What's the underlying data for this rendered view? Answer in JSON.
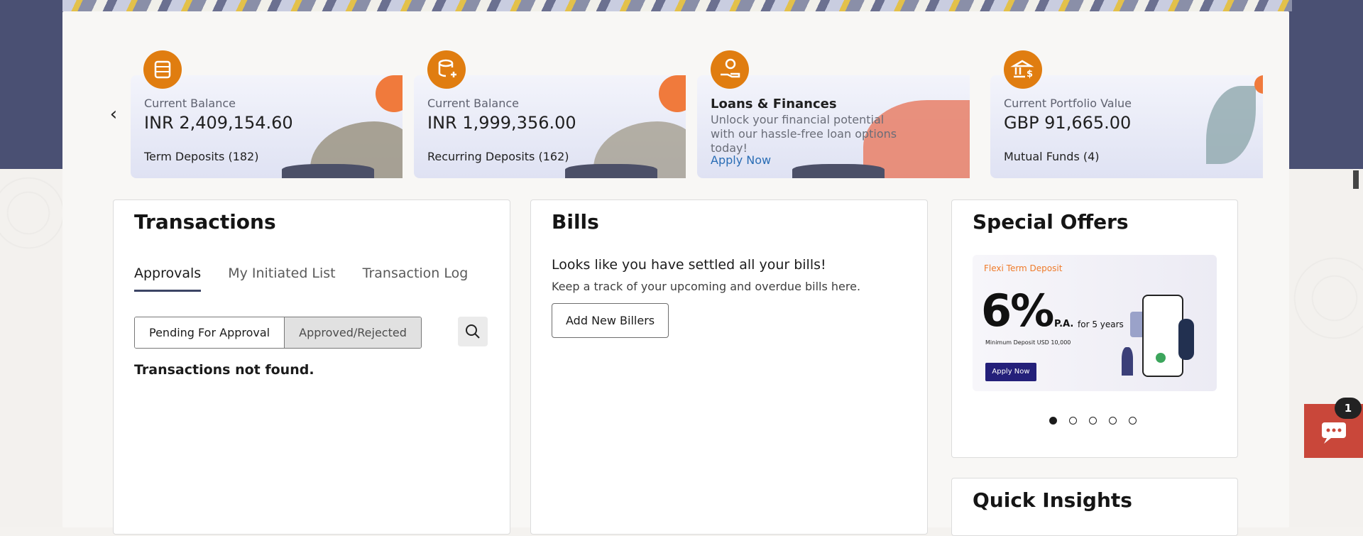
{
  "colors": {
    "hero_band": "#4a5073",
    "accent_orange": "#e07d10",
    "tab_underline": "#3c4565",
    "chat_button": "#c9473a",
    "link": "#2a6db5"
  },
  "carousel": {
    "prev_icon": "chevron-left-icon",
    "cards": [
      {
        "icon": "coins-stack-icon",
        "label": "Current Balance",
        "value": "INR 2,409,154.60",
        "footer": "Term Deposits (182)"
      },
      {
        "icon": "coins-plus-icon",
        "label": "Current Balance",
        "value": "INR 1,999,356.00",
        "footer": "Recurring Deposits (162)"
      },
      {
        "icon": "hand-coin-icon",
        "title": "Loans & Finances",
        "description": "Unlock your financial potential with our hassle-free loan options today!",
        "link": "Apply Now"
      },
      {
        "icon": "bank-dollar-icon",
        "label": "Current Portfolio Value",
        "value": "GBP 91,665.00",
        "footer": "Mutual Funds (4)"
      }
    ]
  },
  "transactions": {
    "title": "Transactions",
    "tabs": [
      {
        "label": "Approvals",
        "active": true
      },
      {
        "label": "My Initiated List",
        "active": false
      },
      {
        "label": "Transaction Log",
        "active": false
      }
    ],
    "filters": [
      {
        "label": "Pending For Approval",
        "selected": false
      },
      {
        "label": "Approved/Rejected",
        "selected": true
      }
    ],
    "search_icon": "search-icon",
    "empty_message": "Transactions not found."
  },
  "bills": {
    "title": "Bills",
    "headline": "Looks like you have settled all your bills!",
    "subtext": "Keep a track of your upcoming and overdue bills here.",
    "add_button": "Add New Billers"
  },
  "special_offers": {
    "title": "Special Offers",
    "banner": {
      "product": "Flexi Term Deposit",
      "rate": "6%",
      "rate_suffix": "P.A.",
      "term": "for 5 years",
      "min_deposit": "Minimum Deposit USD 10,000",
      "cta": "Apply Now"
    },
    "dots_count": 5,
    "active_dot": 0
  },
  "quick_insights": {
    "title": "Quick Insights"
  },
  "chat": {
    "icon": "chat-bubble-icon",
    "badge": "1"
  }
}
